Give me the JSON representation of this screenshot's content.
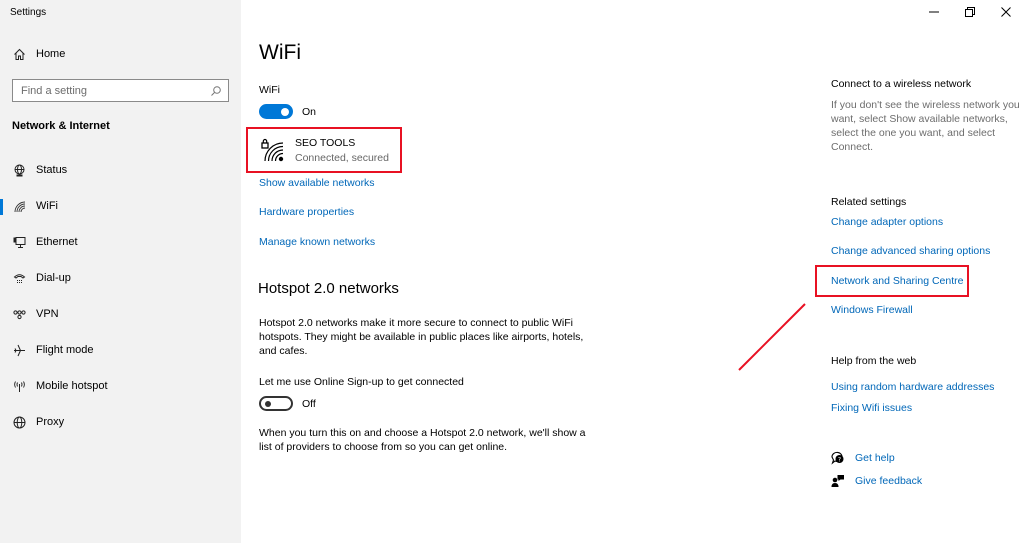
{
  "window": {
    "title": "Settings",
    "controls": {
      "minimize": "minimize-icon",
      "restore": "restore-icon",
      "close": "close-icon"
    }
  },
  "sidebar": {
    "home_label": "Home",
    "search_placeholder": "Find a setting",
    "section_title": "Network & Internet",
    "items": [
      {
        "label": "Status",
        "icon": "status-globe-icon",
        "active": false
      },
      {
        "label": "WiFi",
        "icon": "wifi-icon",
        "active": true
      },
      {
        "label": "Ethernet",
        "icon": "ethernet-icon",
        "active": false
      },
      {
        "label": "Dial-up",
        "icon": "dialup-icon",
        "active": false
      },
      {
        "label": "VPN",
        "icon": "vpn-icon",
        "active": false
      },
      {
        "label": "Flight mode",
        "icon": "airplane-icon",
        "active": false
      },
      {
        "label": "Mobile hotspot",
        "icon": "hotspot-icon",
        "active": false
      },
      {
        "label": "Proxy",
        "icon": "globe-icon",
        "active": false
      }
    ],
    "accent": "#0078d7"
  },
  "main": {
    "title": "WiFi",
    "wifi_label": "WiFi",
    "wifi_toggle": {
      "state": "On",
      "on": true
    },
    "network": {
      "name": "SEO TOOLS",
      "status": "Connected, secured"
    },
    "links": [
      "Show available networks",
      "Hardware properties",
      "Manage known networks"
    ],
    "hotspot": {
      "heading": "Hotspot 2.0 networks",
      "description": "Hotspot 2.0 networks make it more secure to connect to public WiFi hotspots. They might be available in public places like airports, hotels, and cafes.",
      "signup_label": "Let me use Online Sign-up to get connected",
      "signup_toggle": {
        "state": "Off",
        "on": false
      },
      "footer": "When you turn this on and choose a Hotspot 2.0 network, we'll show a list of providers to choose from so you can get online."
    }
  },
  "right": {
    "connect_title": "Connect to a wireless network",
    "connect_text": "If you don't see the wireless network you want, select Show available networks, select the one you want, and select Connect.",
    "related_title": "Related settings",
    "related_links": [
      "Change adapter options",
      "Change advanced sharing options",
      "Network and Sharing Centre",
      "Windows Firewall"
    ],
    "help_title": "Help from the web",
    "help_links": [
      "Using random hardware addresses",
      "Fixing Wifi issues"
    ],
    "get_help": "Get help",
    "give_feedback": "Give feedback"
  },
  "annotations": {
    "highlight_color": "#e81123"
  },
  "colors": {
    "link": "#0067b8",
    "secondary_text": "#6d6d6d"
  }
}
